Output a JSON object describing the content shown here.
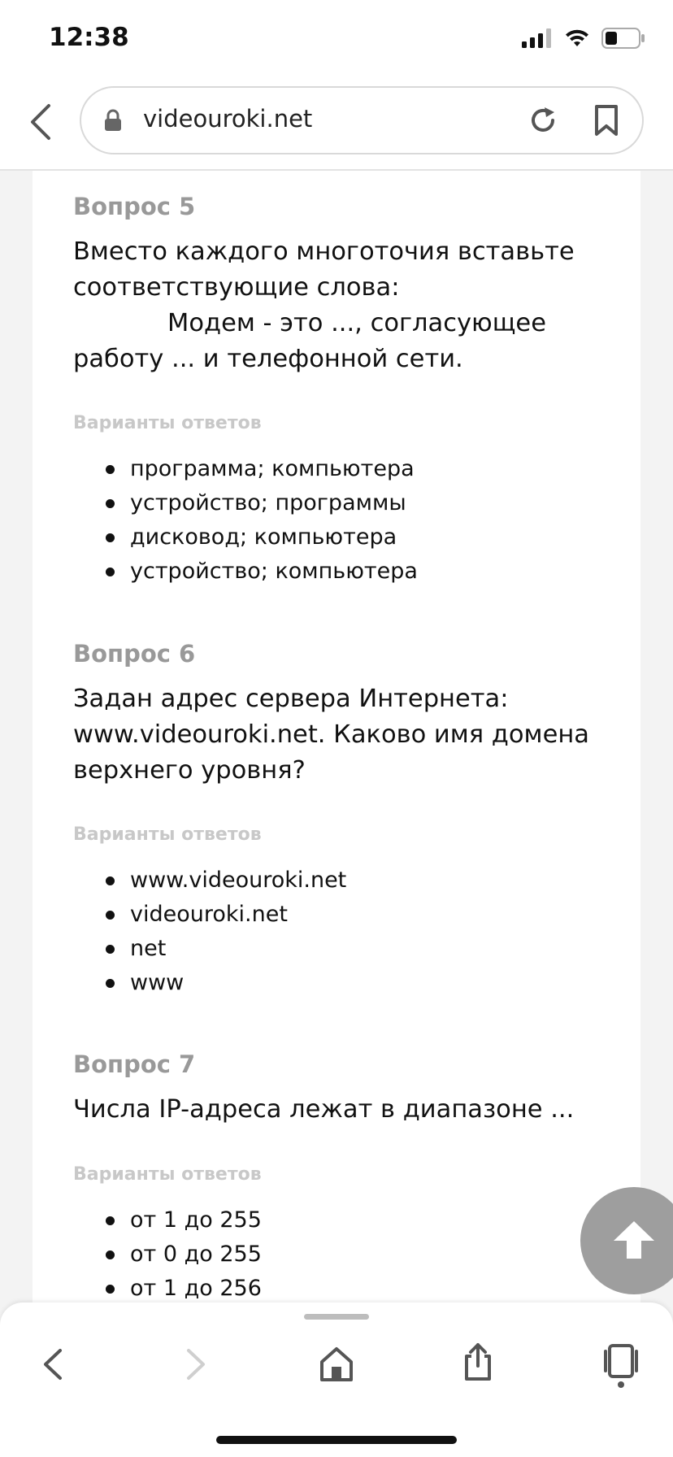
{
  "status_bar": {
    "time": "12:38"
  },
  "browser": {
    "url": "videouroki.net"
  },
  "questions": [
    {
      "title": "Вопрос 5",
      "lines": [
        "Вместо каждого многоточия вставьте",
        "соответствующие слова:",
        "Модем - это ..., согласующее",
        "работу ... и телефонной сети."
      ],
      "variants_label": "Варианты ответов",
      "answers": [
        "программа; компьютера",
        "устройство; программы",
        "дисковод; компьютера",
        "устройство; компьютера"
      ]
    },
    {
      "title": "Вопрос 6",
      "lines": [
        "Задан адрес сервера Интернета:",
        "www.videouroki.net. Каково имя домена",
        "верхнего уровня?"
      ],
      "variants_label": "Варианты ответов",
      "answers": [
        "www.videouroki.net",
        "videouroki.net",
        "net",
        "www"
      ]
    },
    {
      "title": "Вопрос 7",
      "lines": [
        "Числа IP-адреса лежат в диапазоне ..."
      ],
      "variants_label": "Варианты ответов",
      "answers": [
        "от 1 до 255",
        "от 0 до 255",
        "от 1 до 256"
      ]
    }
  ],
  "icons": {
    "back": "chevron-left-icon",
    "forward": "chevron-right-icon",
    "home": "home-icon",
    "share": "share-icon",
    "tabs": "tabs-icon",
    "scroll_up": "arrow-up-icon"
  }
}
